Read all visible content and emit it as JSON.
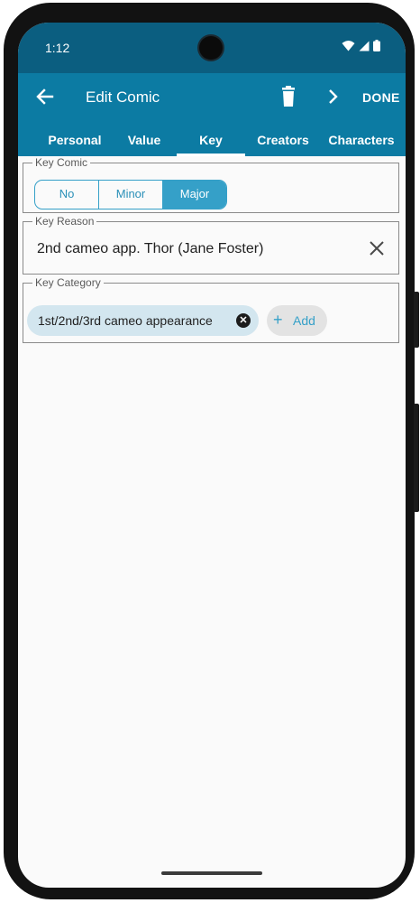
{
  "status_bar": {
    "time": "1:12",
    "icons": [
      "wifi-icon",
      "cellular-signal-icon",
      "battery-icon"
    ]
  },
  "app_bar": {
    "title": "Edit Comic",
    "back_icon": "arrow-left-icon",
    "delete_icon": "trash-icon",
    "next_icon": "chevron-right-icon",
    "done_label": "DONE",
    "color": "#0c7ba3"
  },
  "tabs": [
    {
      "label": "Personal",
      "active": false
    },
    {
      "label": "Value",
      "active": false
    },
    {
      "label": "Key",
      "active": true
    },
    {
      "label": "Creators",
      "active": false
    },
    {
      "label": "Characters",
      "active": false
    }
  ],
  "key_comic": {
    "legend": "Key Comic",
    "options": [
      "No",
      "Minor",
      "Major"
    ],
    "selected": "Major",
    "accent": "#35a0c8"
  },
  "key_reason": {
    "legend": "Key Reason",
    "value": "2nd cameo app. Thor (Jane Foster)",
    "clear_icon": "close-icon"
  },
  "key_category": {
    "legend": "Key Category",
    "chips": [
      {
        "label": "1st/2nd/3rd cameo appearance",
        "remove_icon": "close-circle-icon"
      }
    ],
    "add_label": "Add",
    "add_icon": "plus-icon"
  }
}
